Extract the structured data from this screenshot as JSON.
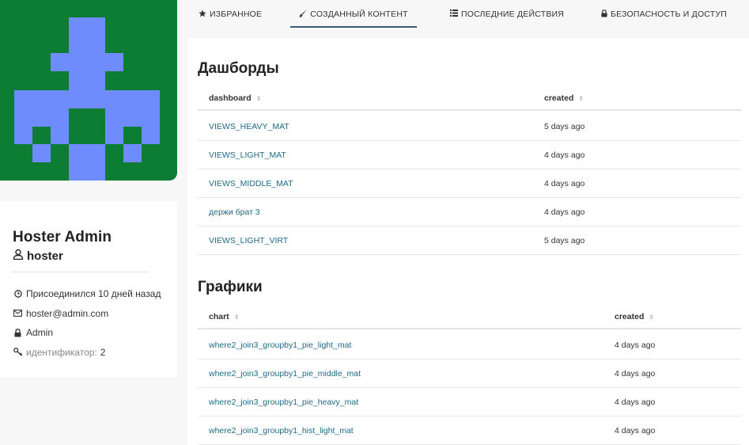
{
  "avatar": {
    "bg": "#0e7d34",
    "fg": "#6f8cff"
  },
  "tabs": [
    {
      "icon": "star-icon",
      "label": "ИЗБРАННОЕ"
    },
    {
      "icon": "paintbrush-icon",
      "label": "СОЗДАННЫЙ КОНТЕНТ"
    },
    {
      "icon": "list-icon",
      "label": "ПОСЛЕДНИЕ ДЕЙСТВИЯ"
    },
    {
      "icon": "lock-icon",
      "label": "БЕЗОПАСНОСТЬ И ДОСТУП"
    }
  ],
  "profile": {
    "name": "Hoster Admin",
    "username": "hoster",
    "joined": "Присоединился 10 дней назад",
    "email": "hoster@admin.com",
    "role": "Admin",
    "id_label": "идентификатор:",
    "id_value": "2"
  },
  "dashboards": {
    "title": "Дашборды",
    "col_name": "dashboard",
    "col_created": "created",
    "rows": [
      {
        "name": "VIEWS_HEAVY_MAT",
        "created": "5 days ago"
      },
      {
        "name": "VIEWS_LIGHT_MAT",
        "created": "4 days ago"
      },
      {
        "name": "VIEWS_MIDDLE_MAT",
        "created": "4 days ago"
      },
      {
        "name": "держи брат 3",
        "created": "4 days ago"
      },
      {
        "name": "VIEWS_LIGHT_VIRT",
        "created": "5 days ago"
      }
    ]
  },
  "charts": {
    "title": "Графики",
    "col_name": "chart",
    "col_created": "created",
    "rows": [
      {
        "name": "where2_join3_groupby1_pie_light_mat",
        "created": "4 days ago"
      },
      {
        "name": "where2_join3_groupby1_pie_middle_mat",
        "created": "4 days ago"
      },
      {
        "name": "where2_join3_groupby1_pie_heavy_mat",
        "created": "4 days ago"
      },
      {
        "name": "where2_join3_groupby1_hist_light_mat",
        "created": "4 days ago"
      }
    ]
  },
  "colors": {
    "link": "#1f6a8a",
    "active_tab": "#3a5a75"
  }
}
